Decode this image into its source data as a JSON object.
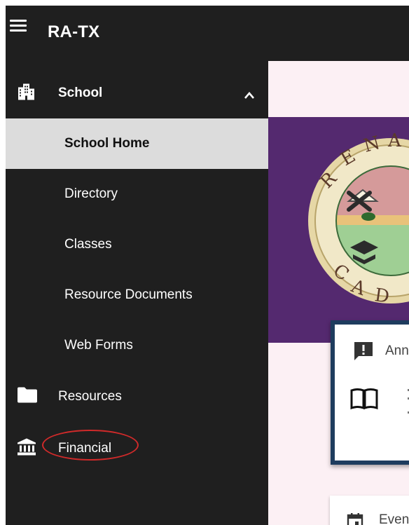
{
  "app": {
    "title": "RA-TX"
  },
  "colors": {
    "sidebar_bg": "#1f1f1f",
    "active_item_bg": "#dcdcdc",
    "content_bg": "#fcf0f4",
    "hero_bg": "#54296f",
    "card_border": "#1e3c5e",
    "annotation_ring": "#d02a2a"
  },
  "sidebar": {
    "school": {
      "label": "School",
      "icon": "school-building-icon",
      "expanded": true,
      "expand_icon": "chevron-up-icon"
    },
    "school_items": [
      {
        "label": "School Home",
        "active": true
      },
      {
        "label": "Directory",
        "active": false
      },
      {
        "label": "Classes",
        "active": false
      },
      {
        "label": "Resource Documents",
        "active": false
      },
      {
        "label": "Web Forms",
        "active": false
      }
    ],
    "resources": {
      "label": "Resources",
      "icon": "folder-icon"
    },
    "financial": {
      "label": "Financial",
      "icon": "bank-icon",
      "highlighted": true
    }
  },
  "main": {
    "banner": {
      "emblem_text": "REN   AIS   CAI"
    },
    "announcements": {
      "label": "Ann",
      "icon": "announcement-icon",
      "item_icon": "open-book-icon"
    },
    "events": {
      "label": "Even",
      "icon": "calendar-icon"
    }
  }
}
